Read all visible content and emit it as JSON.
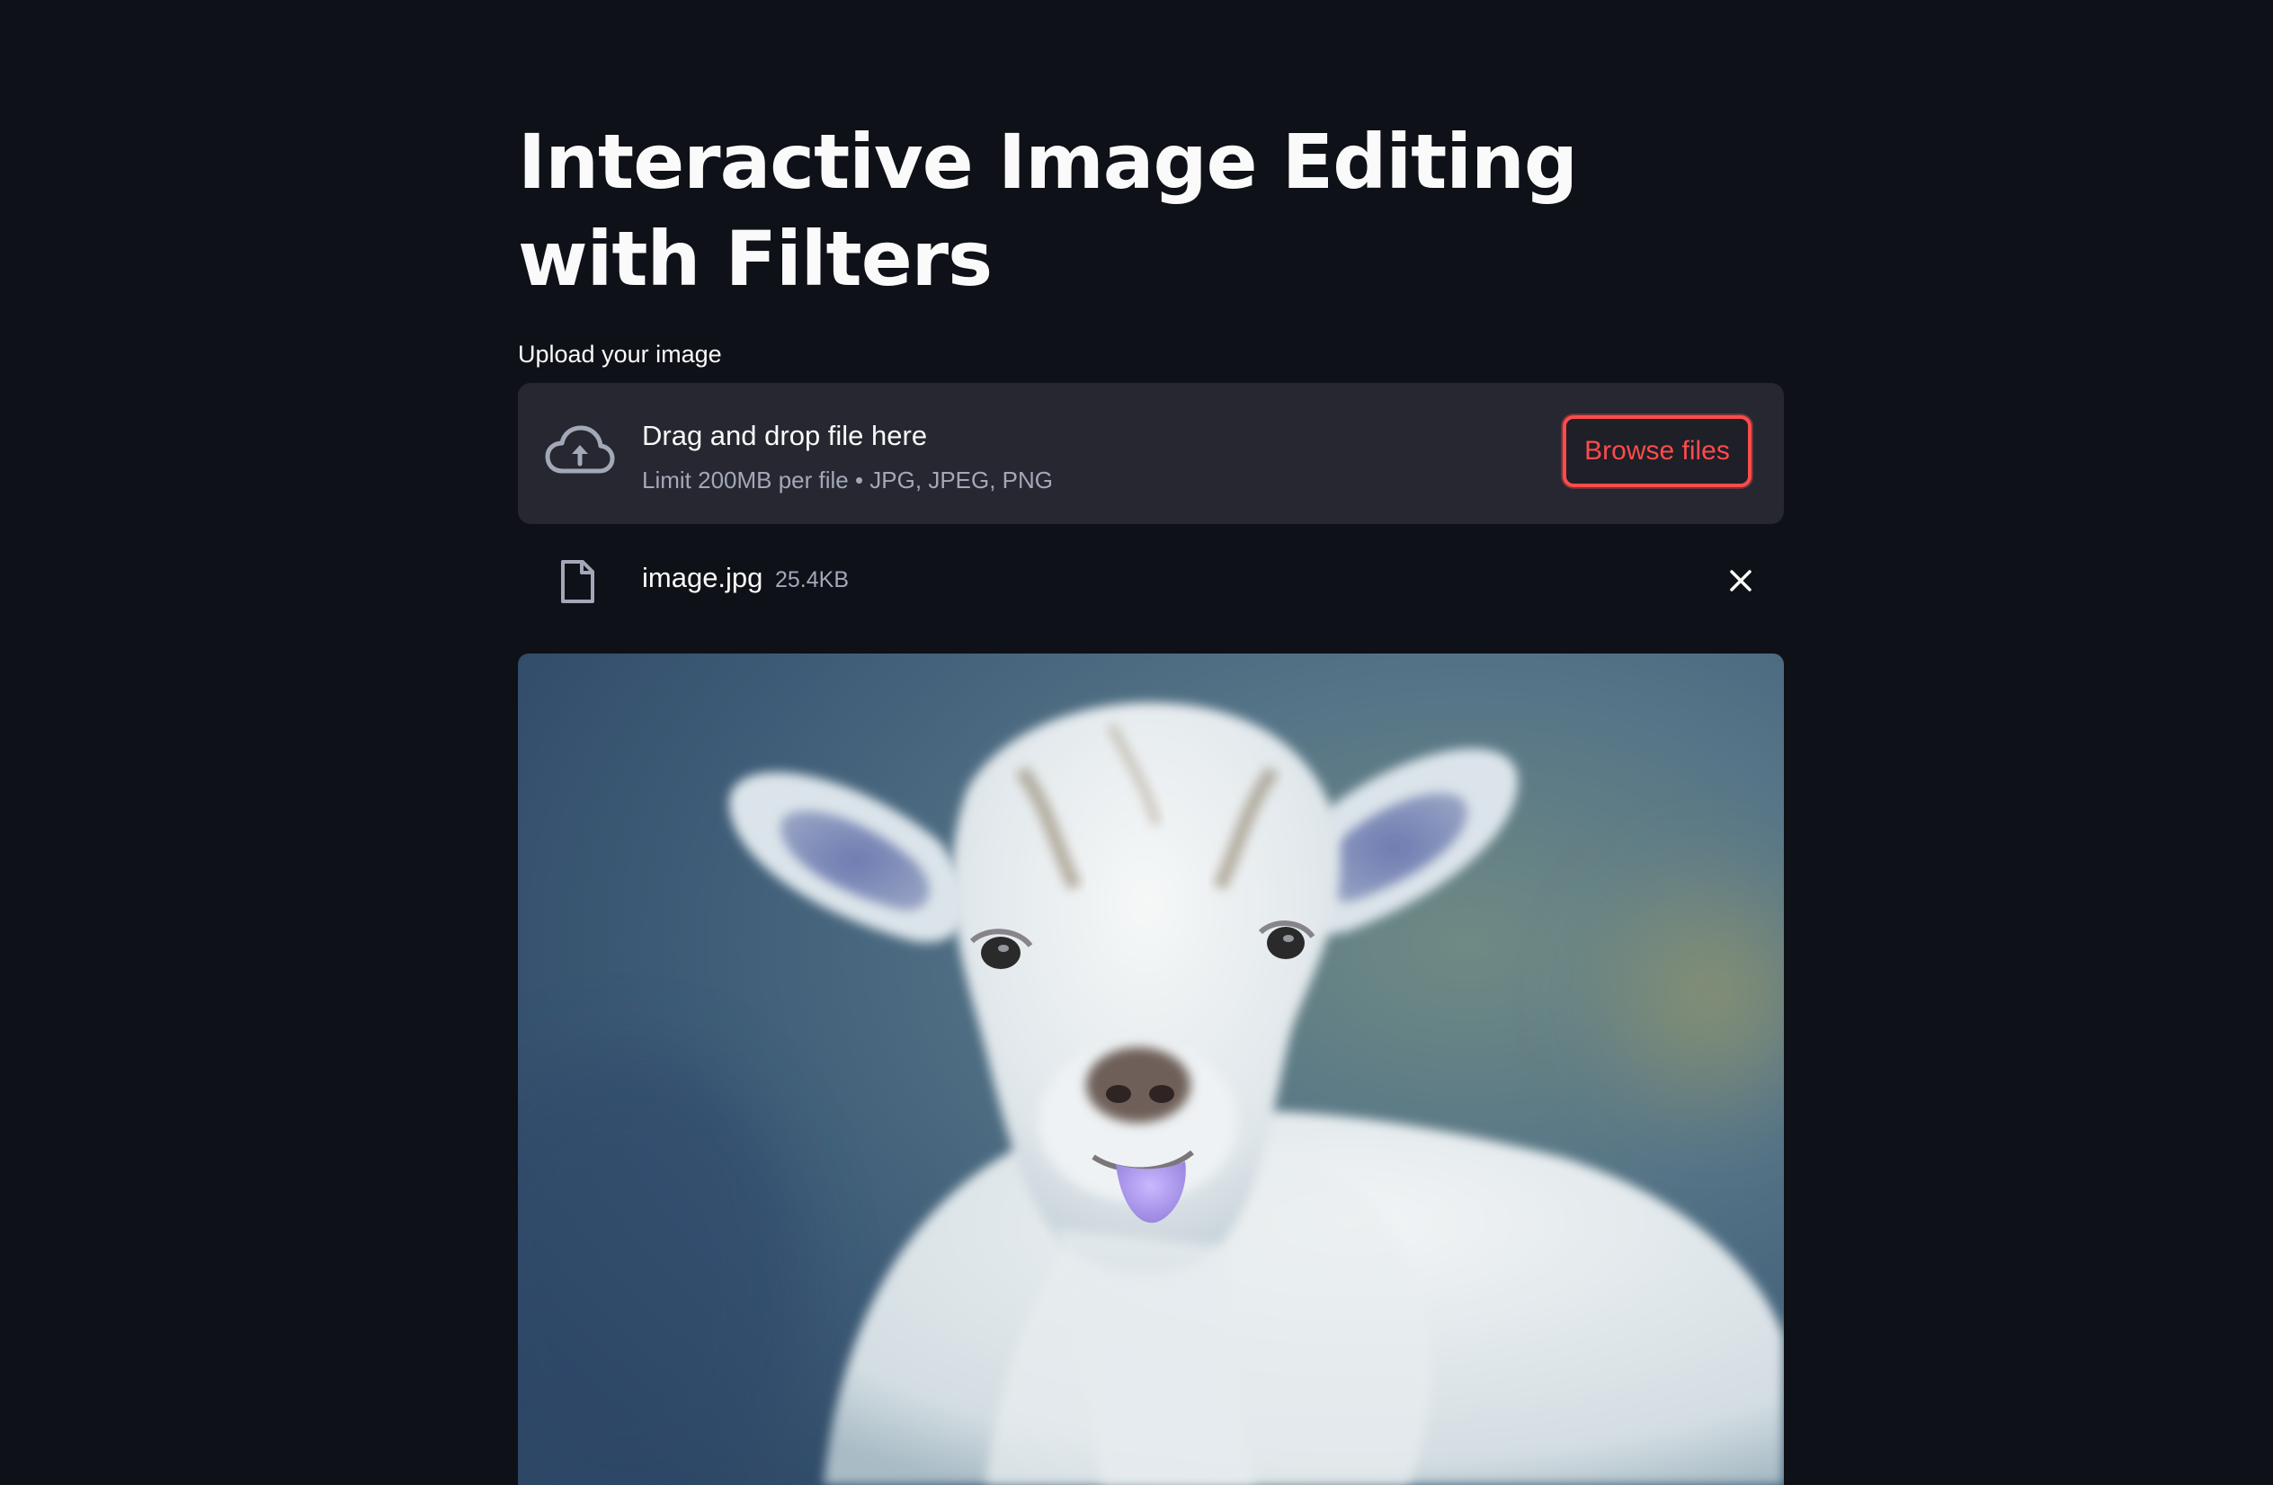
{
  "header": {
    "title": "Interactive Image Editing with Filters"
  },
  "uploader": {
    "label": "Upload your image",
    "drop_title": "Drag and drop file here",
    "drop_subtitle": "Limit 200MB per file • JPG, JPEG, PNG",
    "browse_label": "Browse files",
    "icon": "cloud-upload-icon"
  },
  "uploaded_file": {
    "name": "image.jpg",
    "size": "25.4KB",
    "icon": "file-icon",
    "remove_icon": "close-icon"
  },
  "preview": {
    "subject": "goat-kid-photo"
  },
  "colors": {
    "background": "#0e1117",
    "dropzone": "#262730",
    "accent": "#ff4b4b",
    "muted_text": "#a3a8b8"
  }
}
